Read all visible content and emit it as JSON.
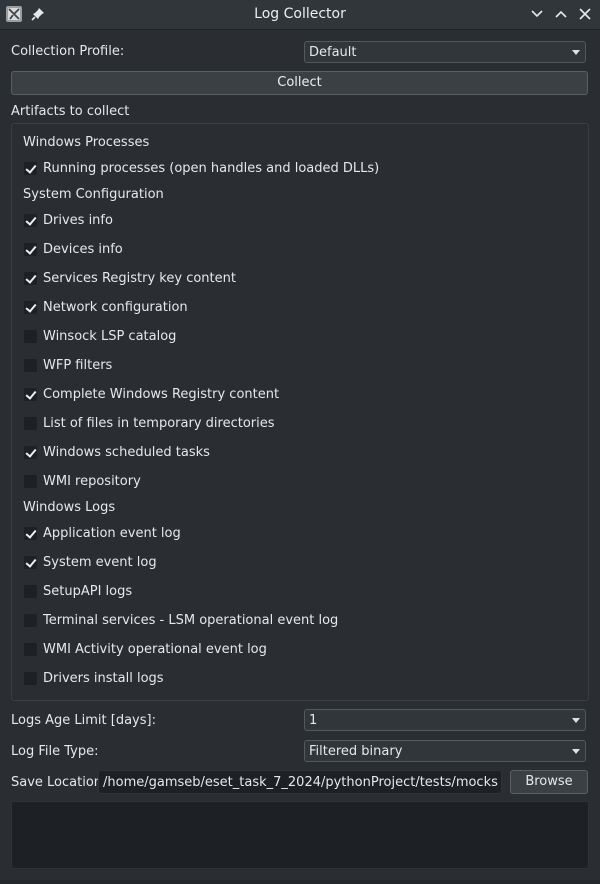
{
  "window": {
    "title": "Log Collector"
  },
  "profile": {
    "label": "Collection Profile:",
    "value": "Default"
  },
  "collect_button": "Collect",
  "artifacts": {
    "heading": "Artifacts to collect",
    "sections": [
      {
        "name": "Windows Processes",
        "items": [
          {
            "label": "Running processes (open handles and loaded DLLs)",
            "checked": true
          }
        ]
      },
      {
        "name": "System Configuration",
        "items": [
          {
            "label": "Drives info",
            "checked": true
          },
          {
            "label": "Devices info",
            "checked": true
          },
          {
            "label": "Services Registry key content",
            "checked": true
          },
          {
            "label": "Network configuration",
            "checked": true
          },
          {
            "label": "Winsock LSP catalog",
            "checked": false
          },
          {
            "label": "WFP filters",
            "checked": false
          },
          {
            "label": "Complete Windows Registry content",
            "checked": true
          },
          {
            "label": "List of files in temporary directories",
            "checked": false
          },
          {
            "label": "Windows scheduled tasks",
            "checked": true
          },
          {
            "label": "WMI repository",
            "checked": false
          }
        ]
      },
      {
        "name": "Windows Logs",
        "items": [
          {
            "label": "Application event log",
            "checked": true
          },
          {
            "label": "System event log",
            "checked": true
          },
          {
            "label": "SetupAPI logs",
            "checked": false
          },
          {
            "label": "Terminal services - LSM operational event log",
            "checked": false
          },
          {
            "label": "WMI Activity operational event log",
            "checked": false
          },
          {
            "label": "Drivers install logs",
            "checked": false
          }
        ]
      }
    ]
  },
  "age_limit": {
    "label": "Logs Age Limit [days]:",
    "value": "1"
  },
  "file_type": {
    "label": "Log File Type:",
    "value": "Filtered binary"
  },
  "save_location": {
    "label": "Save Location:",
    "value": "/home/gamseb/eset_task_7_2024/pythonProject/tests/mocks",
    "browse_label": "Browse"
  },
  "log_output": ""
}
